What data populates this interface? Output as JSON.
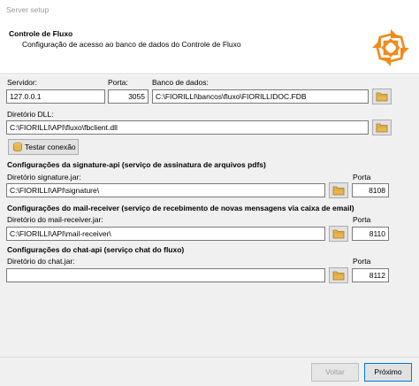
{
  "window": {
    "title": "Server setup"
  },
  "header": {
    "title": "Controle de Fluxo",
    "subtitle": "Configuração de acesso ao banco de dados do Controle de Fluxo"
  },
  "database": {
    "server_label": "Servidor:",
    "server_value": "127.0.0.1",
    "port_label": "Porta:",
    "port_value": "3055",
    "db_label": "Banco de dados:",
    "db_value": "C:\\FIORILLI\\bancos\\fluxo\\FIORILLIDOC.FDB",
    "dll_label": "Diretório DLL:",
    "dll_value": "C:\\FIORILLI\\API\\fluxo\\fbclient.dll",
    "test_button": "Testar conexão"
  },
  "signature": {
    "section_title": "Configurações da signature-api (serviço de assinatura de arquivos pdfs)",
    "dir_label": "Diretório signature.jar:",
    "dir_value": "C:\\FIORILLI\\API\\signature\\",
    "port_label": "Porta",
    "port_value": "8108"
  },
  "mail": {
    "section_title": "Configurações do mail-receiver (serviço de recebimento de novas mensagens via caixa de email)",
    "dir_label": "Diretório do mail-receiver.jar:",
    "dir_value": "C:\\FIORILLI\\API\\mail-receiver\\",
    "port_label": "Porta",
    "port_value": "8110"
  },
  "chat": {
    "section_title": "Configurações do chat-api (serviço chat do fluxo)",
    "dir_label": "Diretório do chat.jar:",
    "dir_value": "",
    "port_label": "Porta",
    "port_value": "8112"
  },
  "footer": {
    "back_label": "Voltar",
    "next_label": "Próximo"
  },
  "icons": {
    "folder": "folder-icon",
    "logo": "fiorilli-logo",
    "test": "database-icon"
  },
  "colors": {
    "logo_orange": "#f08a1c",
    "folder_yellow": "#e8b64a",
    "primary_border": "#0078d7"
  }
}
